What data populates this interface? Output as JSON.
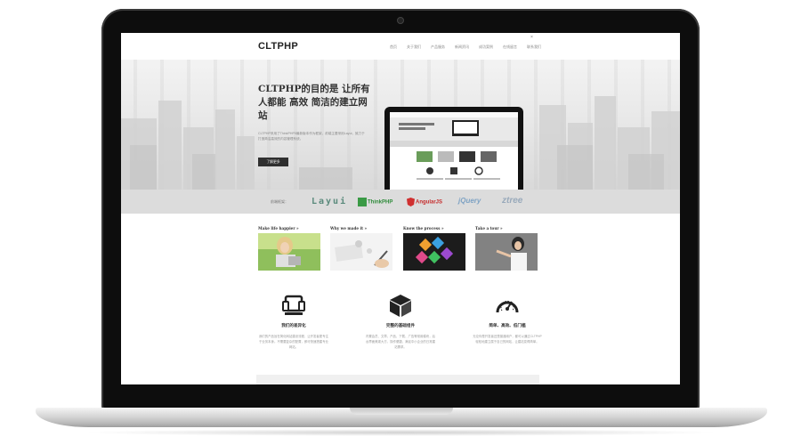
{
  "site": {
    "logo": "CLTPHP",
    "nav": [
      "首页",
      "关于我们",
      "产品服务",
      "新闻资讯",
      "成功案例",
      "在线留言",
      "联系我们"
    ],
    "close": "×"
  },
  "hero": {
    "title": "CLTPHP的目的是 让所有人都能 高效 简洁的建立网站",
    "description": "CLTPHP采用了ThinkPHP5最新版本作为框架，前端主要采用Layui，致力于打造简洁高效的内容管理系统。",
    "button": "了解更多"
  },
  "tech": {
    "label": "前端框架：",
    "brands": [
      "Layui",
      "ThinkPHP",
      "AngularJS",
      "jQuery",
      "ztree"
    ]
  },
  "features": [
    {
      "label": "Make life happier »"
    },
    {
      "label": "Why we made it »"
    },
    {
      "label": "Know the process »"
    },
    {
      "label": "Take a tour »"
    }
  ],
  "columns": [
    {
      "title": "我们的差异化",
      "text": "我们的产品旨在简化网站建设流程，让开发者更专注于业务本身。不需要复杂的配置，即可快速搭建专业网站。",
      "icon": "device-icon"
    },
    {
      "title": "完整的基础组件",
      "text": "内置会员、文章、产品、下载、广告等常用模块，后台界面美观大方，操作便捷，满足中小企业的日常建站需求。",
      "icon": "cube-icon"
    },
    {
      "title": "简单、高效、低门槛",
      "text": "无论你是开发者还是普通用户，都可以通过CLTPHP轻松地建立属于自己的网站，让建站变得简单。",
      "icon": "gauge-icon"
    }
  ],
  "colors": {
    "bezel": "#0d0d0d",
    "strip": "#dcdcdc",
    "button": "#2f2f2f"
  }
}
